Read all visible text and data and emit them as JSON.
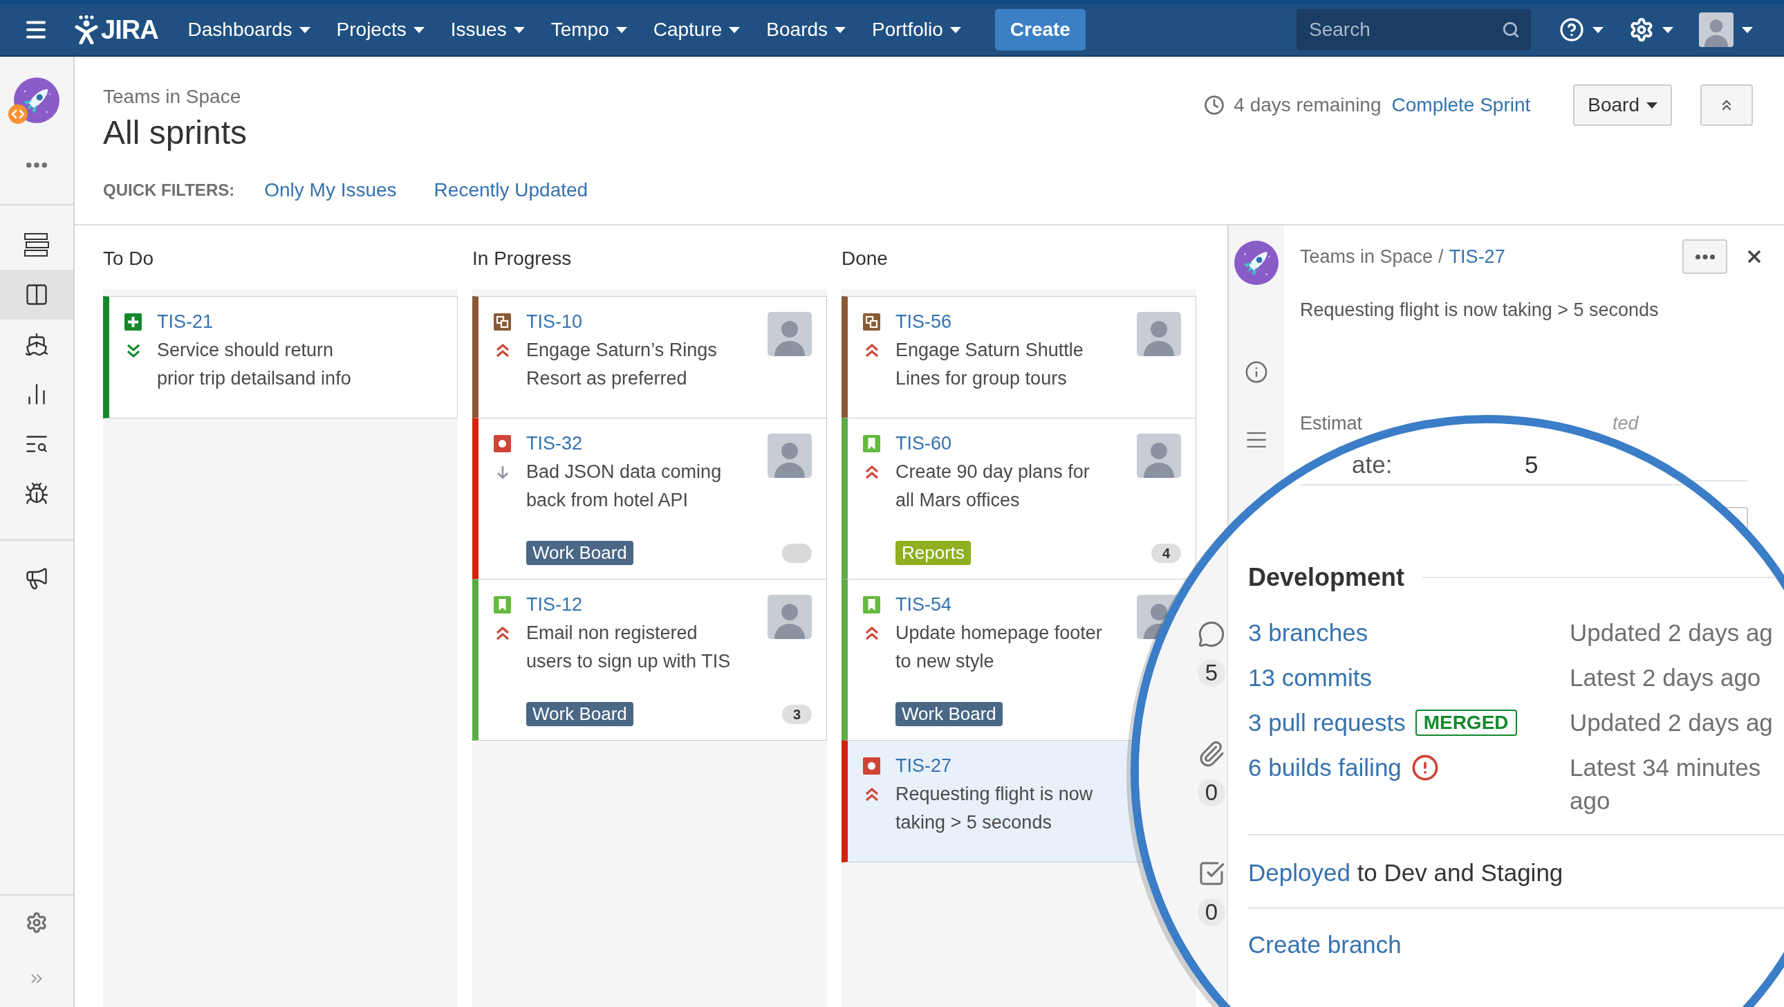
{
  "top_nav": {
    "logo_text": "JIRA",
    "menus": [
      {
        "label": "Dashboards"
      },
      {
        "label": "Projects"
      },
      {
        "label": "Issues"
      },
      {
        "label": "Tempo"
      },
      {
        "label": "Capture"
      },
      {
        "label": "Boards"
      },
      {
        "label": "Portfolio"
      }
    ],
    "create_label": "Create",
    "search": {
      "placeholder": "Search"
    }
  },
  "sidebar": {
    "sections": [
      {
        "items": [
          {
            "kind": "rows",
            "selected": false
          },
          {
            "kind": "columns",
            "selected": true
          },
          {
            "kind": "ship",
            "selected": false
          },
          {
            "kind": "bars",
            "selected": false
          },
          {
            "kind": "search_list",
            "selected": false
          },
          {
            "kind": "bug",
            "selected": false
          }
        ]
      },
      {
        "items": [
          {
            "kind": "megaphone",
            "selected": false
          }
        ]
      }
    ]
  },
  "page_header": {
    "project": "Teams in Space",
    "title": "All sprints",
    "remaining": "4 days remaining",
    "complete_sprint": "Complete Sprint",
    "view_menu": "Board"
  },
  "quick_filters": {
    "label": "QUICK FILTERS:",
    "filters": [
      {
        "label": "Only My Issues"
      },
      {
        "label": "Recently Updated"
      }
    ]
  },
  "board": {
    "columns": [
      {
        "title": "To Do",
        "cards": [
          {
            "key": "TIS-21",
            "summary": "Service should return prior trip detailsand info",
            "type_icon": {
              "kind": "plus"
            },
            "priority_icon": {
              "kind": "lowest"
            },
            "color": "#14892c",
            "avatar": false,
            "selected": false
          }
        ]
      },
      {
        "title": "In Progress",
        "cards": [
          {
            "key": "TIS-10",
            "summary": "Engage Saturn’s Rings Resort as preferred",
            "type_icon": {
              "kind": "squares"
            },
            "priority_icon": {
              "kind": "highest"
            },
            "color": "#8b5a35",
            "avatar": true,
            "selected": false
          },
          {
            "key": "TIS-32",
            "summary": "Bad JSON data coming back from hotel API",
            "type_icon": {
              "kind": "dot"
            },
            "priority_icon": {
              "kind": "low"
            },
            "color": "#d4220f",
            "avatar": true,
            "selected": false,
            "epic": {
              "label": "Work Board",
              "color": "#4a6785"
            },
            "estimate": {
              "kind": "empty"
            }
          },
          {
            "key": "TIS-12",
            "summary": "Email non registered users to sign up with TIS",
            "type_icon": {
              "kind": "bookmark"
            },
            "priority_icon": {
              "kind": "highest"
            },
            "color": "#5bab48",
            "avatar": true,
            "selected": false,
            "epic": {
              "label": "Work Board",
              "color": "#4a6785"
            },
            "estimate": {
              "kind": "value",
              "text": "3"
            }
          }
        ]
      },
      {
        "title": "Done",
        "cards": [
          {
            "key": "TIS-56",
            "summary": "Engage Saturn Shuttle Lines for group tours",
            "type_icon": {
              "kind": "squares"
            },
            "priority_icon": {
              "kind": "highest"
            },
            "color": "#8b5a35",
            "avatar": true,
            "selected": false
          },
          {
            "key": "TIS-60",
            "summary": "Create 90 day plans for all Mars offices",
            "type_icon": {
              "kind": "bookmark"
            },
            "priority_icon": {
              "kind": "highest"
            },
            "color": "#5bab48",
            "avatar": true,
            "selected": false,
            "epic": {
              "label": "Reports",
              "color": "#8eb021"
            },
            "estimate": {
              "kind": "value",
              "text": "4"
            }
          },
          {
            "key": "TIS-54",
            "summary": "Update homepage footer to new style",
            "type_icon": {
              "kind": "bookmark"
            },
            "priority_icon": {
              "kind": "highest"
            },
            "color": "#5bab48",
            "avatar": true,
            "selected": false,
            "epic": {
              "label": "Work Board",
              "color": "#4a6785"
            }
          },
          {
            "key": "TIS-27",
            "summary": "Requesting flight is now taking > 5 seconds",
            "type_icon": {
              "kind": "dot"
            },
            "priority_icon": {
              "kind": "highest"
            },
            "color": "#d4220f",
            "avatar": false,
            "selected": true
          }
        ]
      }
    ]
  },
  "detail_panel": {
    "breadcrumb": {
      "project": "Teams in Space",
      "separator": "/",
      "issue_key": "TIS-27"
    },
    "summary": "Requesting flight is now taking > 5 seconds",
    "partial_field": {
      "label": "Estimat",
      "value": "ted"
    }
  },
  "magnifier": {
    "field": {
      "label": "ate:",
      "value": "5"
    },
    "stats": [
      {
        "kind": "comments",
        "count": "5"
      },
      {
        "kind": "attachments",
        "count": "0"
      },
      {
        "kind": "checklist",
        "count": "0"
      }
    ],
    "development": {
      "title": "Development",
      "rows": [
        {
          "link": "3 branches",
          "alert": false,
          "detail": "Updated 2 days ag"
        },
        {
          "link": "13 commits",
          "alert": false,
          "detail": "Latest 2 days ago"
        },
        {
          "link": "3 pull requests",
          "status": "MERGED",
          "alert": false,
          "detail": "Updated 2 days ag"
        },
        {
          "link": "6 builds failing",
          "alert": true,
          "detail": "Latest 34 minutes ago"
        }
      ],
      "deployment": {
        "link": "Deployed",
        "text": "to Dev and Staging"
      },
      "action": "Create branch"
    }
  }
}
